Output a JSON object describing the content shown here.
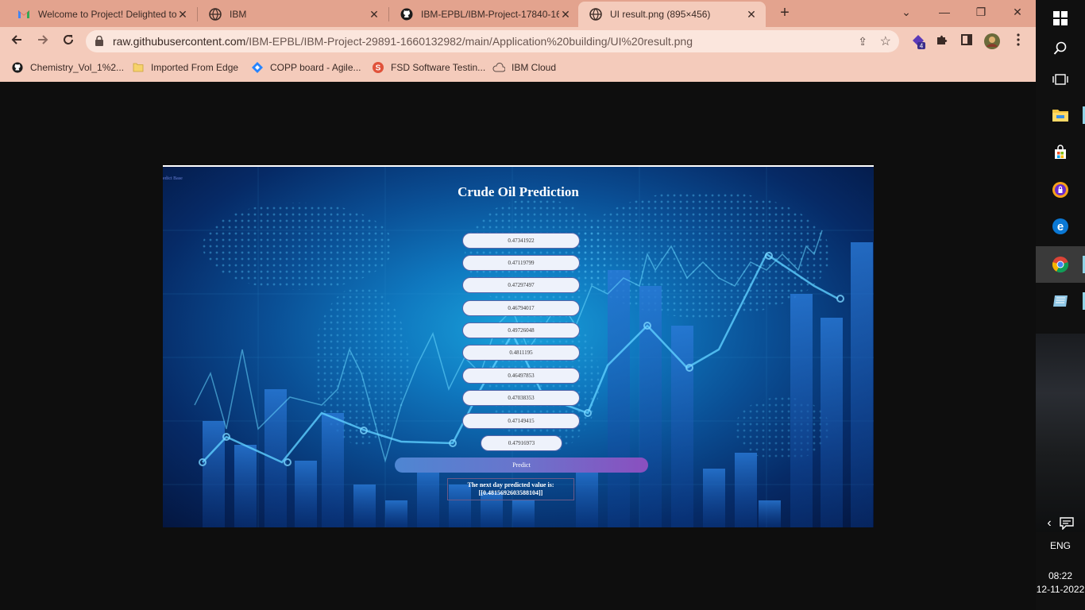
{
  "browser": {
    "tabs": [
      {
        "title": "Welcome to Project! Delighted to",
        "icon": "gmail-icon"
      },
      {
        "title": "IBM",
        "icon": "globe-icon"
      },
      {
        "title": "IBM-EPBL/IBM-Project-17840-16",
        "icon": "github-icon"
      },
      {
        "title": "UI result.png (895×456)",
        "icon": "globe-icon",
        "active": true
      }
    ],
    "url_host": "raw.githubusercontent.com",
    "url_path": "/IBM-EPBL/IBM-Project-29891-1660132982/main/Application%20building/UI%20result.png",
    "extension_badge": "4",
    "bookmarks": [
      {
        "label": "Chemistry_Vol_1%2...",
        "icon": "github-icon"
      },
      {
        "label": "Imported From Edge",
        "icon": "folder-icon"
      },
      {
        "label": "COPP board - Agile...",
        "icon": "jira-icon"
      },
      {
        "label": "FSD Software Testin...",
        "icon": "s-logo-icon"
      },
      {
        "label": "IBM Cloud",
        "icon": "cloud-icon"
      }
    ]
  },
  "app": {
    "tiny_label": "edict Base",
    "title": "Crude Oil Prediction",
    "inputs": [
      "0.47341922",
      "0.47119799",
      "0.47297497",
      "0.46794017",
      "0.49726048",
      "0.4811195",
      "0.46497853",
      "0.47038353",
      "0.47149415",
      "0.47916973"
    ],
    "predict_label": "Predict",
    "result_line1": "The next day predicted value is:",
    "result_line2": "[[0.4815692603588104]]"
  },
  "taskbar": {
    "language": "ENG",
    "time": "08:22",
    "date": "12-11-2022"
  },
  "colors": {
    "chrome": "#e3a38e",
    "toolbar": "#f4cbbb",
    "app_accent": "#1aa3dc",
    "predict_gradient_start": "#4e86d2",
    "predict_gradient_end": "#8a4fbf"
  }
}
